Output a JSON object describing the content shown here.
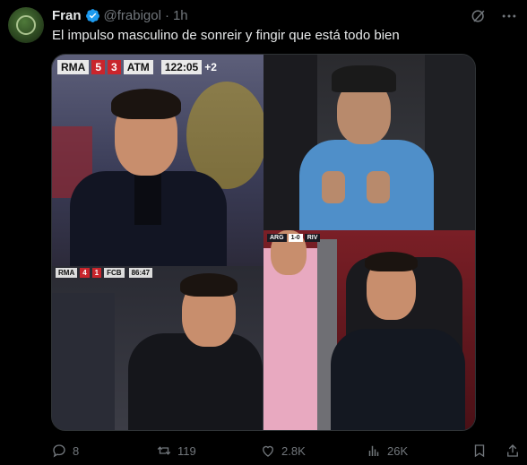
{
  "post": {
    "author_name": "Fran",
    "handle": "@frabigol",
    "separator": "·",
    "time": "1h",
    "text": "El impulso masculino de sonreir y fingir que está todo bien"
  },
  "media": {
    "panel1_scoreboard": {
      "home": "RMA",
      "home_score": "5",
      "away_score": "3",
      "away": "ATM",
      "clock": "122:05",
      "extra": "+2"
    },
    "panel3_scoreboard": {
      "home": "RMA",
      "home_score": "4",
      "away_score": "1",
      "away": "FCB",
      "clock": "86:47"
    },
    "panel4_scoreboard": {
      "home": "ARG",
      "score": "1-0",
      "away": "RIV"
    }
  },
  "actions": {
    "replies": "8",
    "reposts": "119",
    "likes": "2.8K",
    "views": "26K"
  },
  "colors": {
    "background": "#000000",
    "text": "#e7e9ea",
    "muted": "#71767b",
    "verified": "#1d9bf0"
  },
  "icons": [
    "grok-icon",
    "more-icon",
    "reply-icon",
    "repost-icon",
    "like-icon",
    "views-icon",
    "bookmark-icon",
    "share-icon",
    "verified-icon"
  ]
}
